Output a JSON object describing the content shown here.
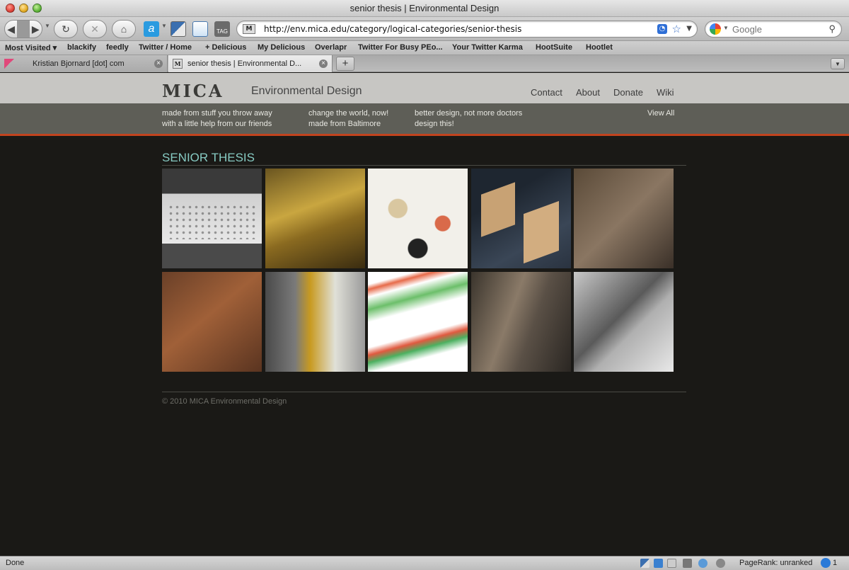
{
  "window": {
    "title": "senior thesis | Environmental Design"
  },
  "toolbar": {
    "url": "http://env.mica.edu/category/logical-categories/senior-thesis",
    "url_favicon": "M",
    "search_placeholder": "Google",
    "tag_label": "TAG"
  },
  "bookmarks": [
    "Most Visited ▾",
    "blackify",
    "feedly",
    "Twitter / Home",
    "+ Delicious",
    "My Delicious",
    "Overlapr",
    "Twitter For Busy PEo...",
    "Your Twitter Karma",
    "HootSuite",
    "Hootlet"
  ],
  "tabs": [
    {
      "label": "Kristian Bjornard [dot] com",
      "active": false
    },
    {
      "label": "senior thesis | Environmental D...",
      "active": true
    }
  ],
  "site": {
    "logo": "MICA",
    "logo_subtitle": "Environmental Design",
    "nav": [
      "Contact",
      "About",
      "Donate",
      "Wiki"
    ],
    "tags": [
      "made from stuff you throw away",
      "with a little help from our friends",
      "change the world, now!",
      "made from Baltimore",
      "better design, not more doctors",
      "design this!"
    ],
    "view_all": "View All",
    "section_title": "SENIOR THESIS",
    "thumbnails": [
      "perforated-white-box-model",
      "gold-folded-paper-model",
      "clay-specimens-on-white",
      "wood-and-acrylic-blocks",
      "city-block-relief-model",
      "carved-wood-cube",
      "painted-block-figures",
      "colored-line-drawing",
      "layered-plaster-relief",
      "grayscale-pixel-map"
    ],
    "copyright": "© 2010 MICA Environmental Design"
  },
  "statusbar": {
    "status": "Done",
    "pagerank": "PageRank: unranked",
    "count": "1"
  },
  "colors": {
    "accent_rule": "#c1431e",
    "section_title": "#87cbc3",
    "page_bg": "#1a1916",
    "subnav_bg": "#5e5e57"
  }
}
